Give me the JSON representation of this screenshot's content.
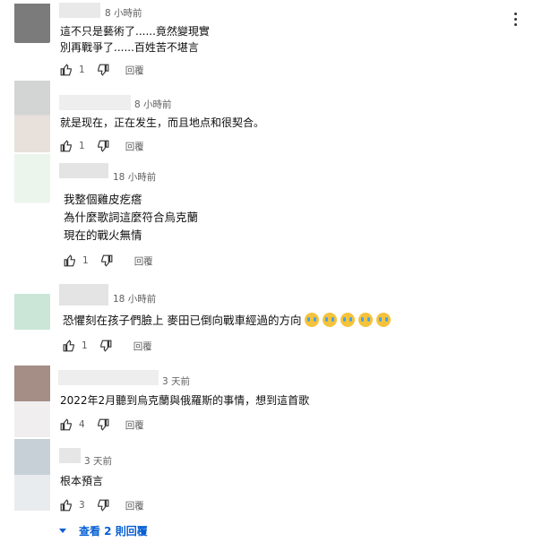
{
  "comments": [
    {
      "time": "8 小時前",
      "lines": [
        "這不只是藝術了......竟然變現實",
        "別再戰爭了......百姓苦不堪言"
      ],
      "likes": "1",
      "reply": "回覆"
    },
    {
      "time": "8 小時前",
      "lines": [
        "就是现在，正在发生，而且地点和很契合。"
      ],
      "likes": "1",
      "reply": "回覆"
    },
    {
      "time": "18 小時前",
      "lines": [
        "我整個雞皮疙瘩",
        "為什麼歌詞這麼符合烏克蘭",
        "現在的戰火無情"
      ],
      "likes": "1",
      "reply": "回覆"
    },
    {
      "time": "18 小時前",
      "lines": [
        "恐懼刻在孩子們臉上 麥田已倒向戰車經過的方向"
      ],
      "emoji_icon": "crying-face-emoji",
      "likes": "1",
      "reply": "回覆"
    },
    {
      "time": "3 天前",
      "lines": [
        "2022年2月聽到烏克蘭與俄羅斯的事情，想到這首歌"
      ],
      "likes": "4",
      "reply": "回覆"
    },
    {
      "time": "3 天前",
      "lines": [
        "根本預言"
      ],
      "likes": "3",
      "reply": "回覆"
    }
  ],
  "view_replies": "查看 2 則回覆",
  "colors": {
    "accent": "#065fd4",
    "meta": "#606060",
    "text": "#0f0f0f"
  },
  "icons": [
    "thumbs-up-icon",
    "thumbs-down-icon",
    "more-vert-icon",
    "chevron-down-icon"
  ]
}
